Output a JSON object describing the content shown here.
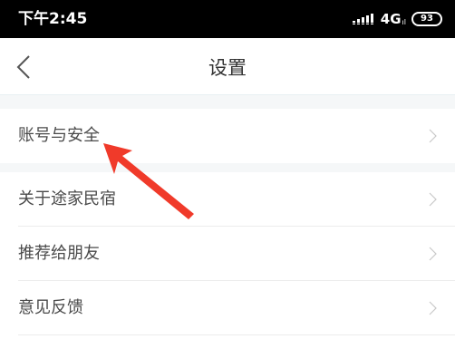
{
  "status_bar": {
    "time": "下午2:45",
    "network": "4G",
    "battery": "93"
  },
  "header": {
    "title": "设置"
  },
  "settings": {
    "items": [
      {
        "label": "账号与安全"
      },
      {
        "label": "关于途家民宿"
      },
      {
        "label": "推荐给朋友"
      },
      {
        "label": "意见反馈"
      }
    ]
  },
  "colors": {
    "status_bg": "#000000",
    "page_bg": "#ffffff",
    "section_gap": "#f5f7f8",
    "text": "#4a4a4a",
    "chevron": "#c8c8c8",
    "annotation_arrow": "#f03a2a"
  },
  "icons": {
    "back": "chevron-left-icon",
    "row": "chevron-right-icon",
    "annotation": "red-arrow-pointer"
  }
}
